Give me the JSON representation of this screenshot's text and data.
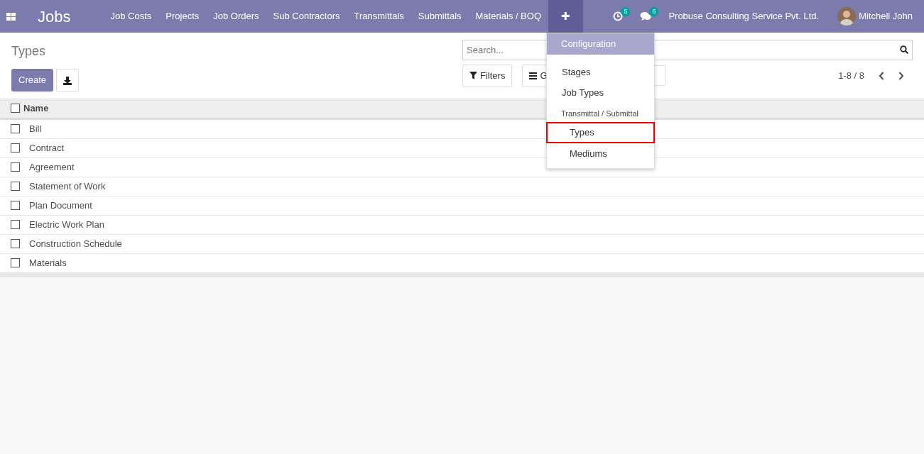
{
  "navbar": {
    "app_title": "Jobs",
    "menu": [
      {
        "label": "Job Costs",
        "selected": false
      },
      {
        "label": "Projects",
        "selected": false
      },
      {
        "label": "Job Orders",
        "selected": false
      },
      {
        "label": "Sub Contractors",
        "selected": false
      },
      {
        "label": "Transmittals",
        "selected": false
      },
      {
        "label": "Submittals",
        "selected": false
      },
      {
        "label": "Materials / BOQ",
        "selected": false
      },
      {
        "label": "✚",
        "selected": true
      }
    ],
    "activity_count": "5",
    "message_count": "6",
    "company": "Probuse Consulting Service Pvt. Ltd.",
    "user": "Mitchell John"
  },
  "dropdown": {
    "items": [
      {
        "kind": "header",
        "label": "Configuration"
      },
      {
        "kind": "item",
        "label": "Stages",
        "highlighted": false
      },
      {
        "kind": "item",
        "label": "Job Types",
        "highlighted": false
      },
      {
        "kind": "section",
        "label": "Transmittal / Submittal"
      },
      {
        "kind": "subitem",
        "label": "Types",
        "highlighted": true
      },
      {
        "kind": "subitem",
        "label": "Mediums",
        "highlighted": false
      }
    ]
  },
  "control_panel": {
    "title": "Types",
    "create_label": "Create",
    "search": {
      "placeholder": "Search..."
    },
    "filters_label": "Filters",
    "group_by_label": "G",
    "pager": "1-8 / 8"
  },
  "table": {
    "all_checked": false,
    "columns": [
      "Name"
    ],
    "rows": [
      {
        "name": "Bill",
        "checked": false
      },
      {
        "name": "Contract",
        "checked": false
      },
      {
        "name": "Agreement",
        "checked": false
      },
      {
        "name": "Statement of Work",
        "checked": false
      },
      {
        "name": "Plan Document",
        "checked": false
      },
      {
        "name": "Electric Work Plan",
        "checked": false
      },
      {
        "name": "Construction Schedule",
        "checked": false
      },
      {
        "name": "Materials",
        "checked": false
      }
    ]
  }
}
